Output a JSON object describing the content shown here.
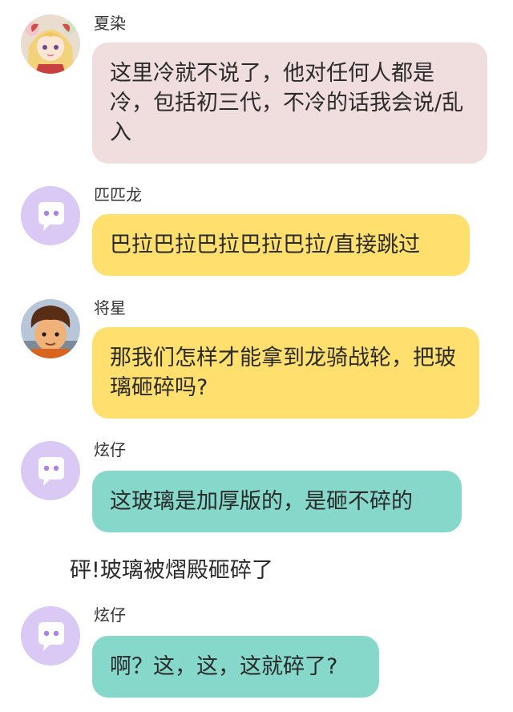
{
  "messages": [
    {
      "sender": "夏染",
      "text": "这里冷就不说了，他对任何人都是冷，包括初三代，不冷的话我会说/乱入",
      "bubble_color": "#f0dede",
      "avatar": "anime-girl-avatar"
    },
    {
      "sender": "匹匹龙",
      "text": "巴拉巴拉巴拉巴拉巴拉/直接跳过",
      "bubble_color": "#ffe06e",
      "avatar": "default-chat-avatar"
    },
    {
      "sender": "将星",
      "text": "那我们怎样才能拿到龙骑战轮，把玻璃砸碎吗?",
      "bubble_color": "#ffe06e",
      "avatar": "boy-character-avatar"
    },
    {
      "sender": "炫仔",
      "text": "这玻璃是加厚版的，是砸不碎的",
      "bubble_color": "#86d8cb",
      "avatar": "default-chat-avatar"
    },
    {
      "sender": "炫仔",
      "text": "啊？这，这，这就碎了?",
      "bubble_color": "#86d8cb",
      "avatar": "default-chat-avatar"
    }
  ],
  "narration": "砰!玻璃被熠殿砸碎了",
  "colors": {
    "default_avatar_bg": "#d9c9f4",
    "default_avatar_icon": "#ffffff",
    "default_avatar_eyes": "#a784e6"
  }
}
